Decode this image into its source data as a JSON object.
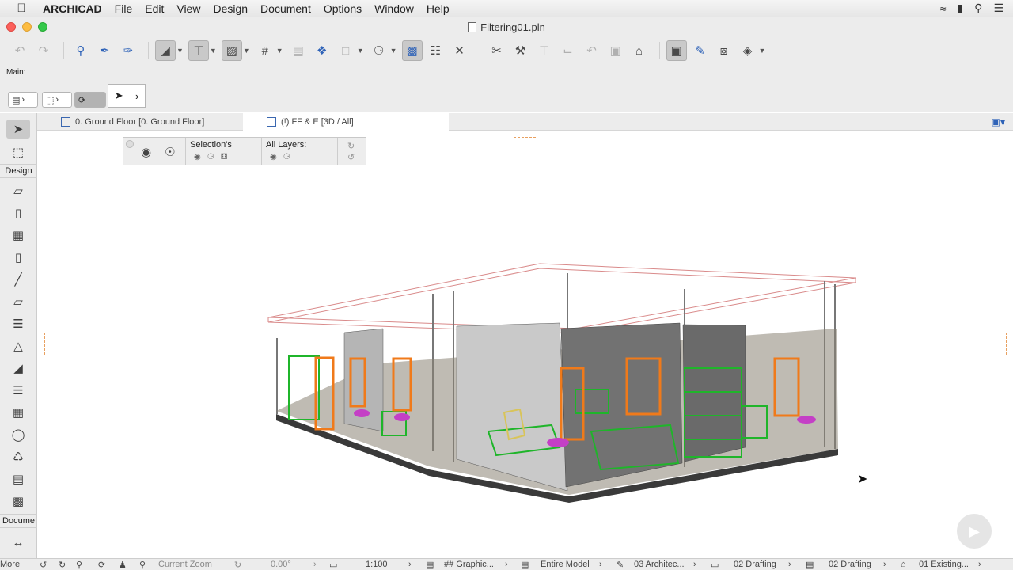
{
  "menubar": {
    "app_name": "ARCHICAD",
    "items": [
      "File",
      "Edit",
      "View",
      "Design",
      "Document",
      "Options",
      "Window",
      "Help"
    ]
  },
  "window": {
    "title": "Filtering01.pln"
  },
  "infobar": {
    "main_label": "Main:"
  },
  "toolbox": {
    "design_label": "Design",
    "document_label": "Docume",
    "more_label": "More"
  },
  "tabs": [
    {
      "label": "0. Ground Floor [0. Ground Floor]"
    },
    {
      "label": "(!) FF & E [3D / All]"
    }
  ],
  "filter_panel": {
    "selection_label": "Selection's",
    "all_layers_label": "All Layers:"
  },
  "statusbar": {
    "zoom_label": "Current Zoom",
    "angle": "0.00°",
    "scale": "1:100",
    "graphic_override": "## Graphic...",
    "model_view": "Entire Model",
    "pen_set": "03 Architec...",
    "dimension": "02 Drafting",
    "partial_structure": "02 Drafting",
    "renovation": "01 Existing..."
  },
  "colors": {
    "traffic_close": "#fc605b",
    "traffic_min": "#fdbc40",
    "traffic_max": "#34c84a",
    "accent": "#2f63b8"
  }
}
